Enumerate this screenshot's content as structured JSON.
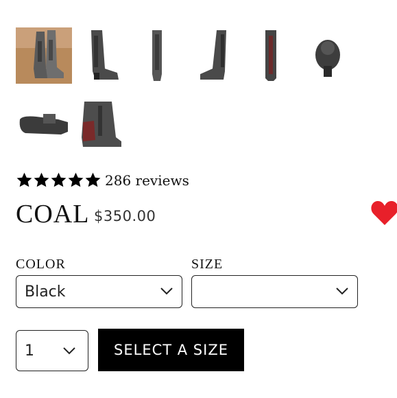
{
  "gallery": {
    "thumbnails": [
      {
        "icon": "boot-lifestyle-photo",
        "selected": true
      },
      {
        "icon": "boot-side-view"
      },
      {
        "icon": "boot-front-view"
      },
      {
        "icon": "boot-side-view-alt"
      },
      {
        "icon": "boot-back-view"
      },
      {
        "icon": "boot-top-view"
      },
      {
        "icon": "boot-sole-view"
      },
      {
        "icon": "boot-detail-view"
      }
    ]
  },
  "rating": {
    "stars": 5,
    "reviews_text": "286 reviews"
  },
  "product": {
    "title": "COAL",
    "price": "$350.00"
  },
  "wishlist": {
    "icon": "heart-icon",
    "color": "#e8202a"
  },
  "options": {
    "color_label": "COLOR",
    "color_value": "Black",
    "size_label": "SIZE",
    "size_value": ""
  },
  "quantity": {
    "value": "1"
  },
  "add_button": {
    "label": "SELECT A SIZE"
  }
}
